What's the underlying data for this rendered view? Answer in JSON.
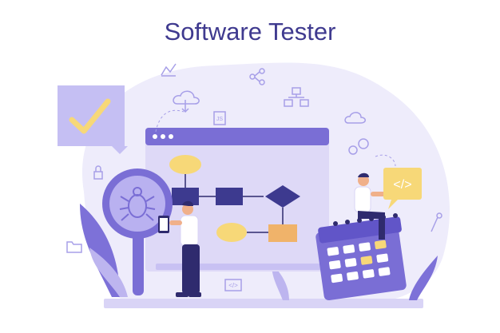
{
  "title": "Software Tester",
  "icons": [
    "chart-icon",
    "share-icon",
    "cloud-download-icon",
    "js-file-icon",
    "hierarchy-icon",
    "cloud-icon",
    "gear-icon",
    "lock-icon",
    "folder-icon",
    "code-tag-icon",
    "wrench-icon",
    "bug-icon",
    "checkmark-icon",
    "phone-icon"
  ],
  "code_bubble_text": "</>",
  "code_icon_text": "</>",
  "js_icon_text": "JS",
  "colors": {
    "accent": "#7f72d9",
    "dark_navy": "#2f2b6e",
    "blob_bg": "#eeecfb",
    "window_bg": "#ded9f7",
    "title_bar": "#7a6ed5",
    "yellow": "#f7d878",
    "orange": "#f0b36a"
  }
}
